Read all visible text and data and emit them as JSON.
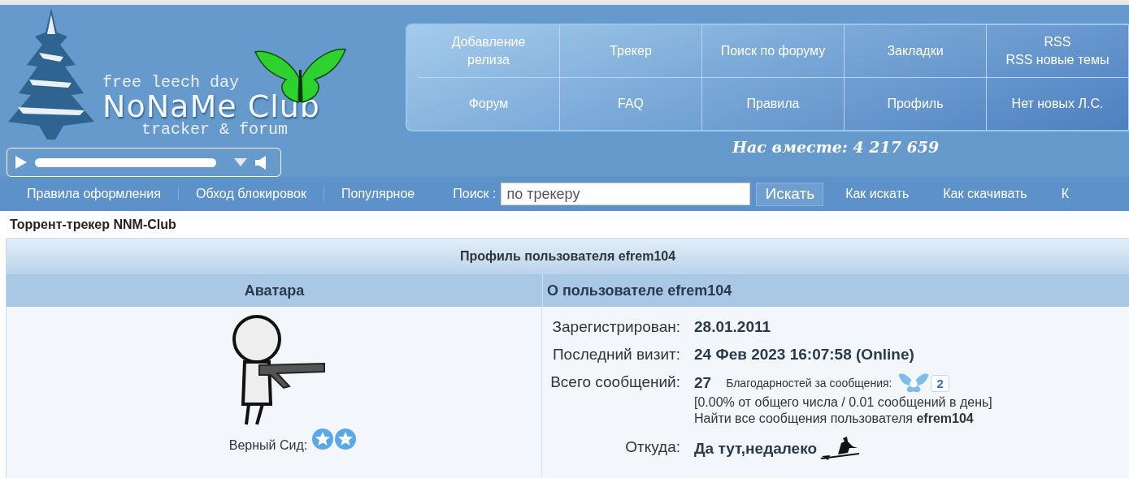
{
  "header": {
    "logo": {
      "tagline": "free leech day",
      "name": "NoNaMe Club",
      "subtitle": "tracker & forum"
    },
    "menu": [
      [
        {
          "labels": [
            "Добавление релиза"
          ]
        },
        {
          "labels": [
            "Трекер"
          ]
        },
        {
          "labels": [
            "Поиск по форуму"
          ]
        },
        {
          "labels": [
            "Закладки"
          ]
        },
        {
          "labels": [
            "RSS",
            "RSS новые темы"
          ]
        }
      ],
      [
        {
          "labels": [
            "Форум"
          ]
        },
        {
          "labels": [
            "FAQ"
          ]
        },
        {
          "labels": [
            "Правила"
          ]
        },
        {
          "labels": [
            "Профиль"
          ]
        },
        {
          "labels": [
            "Нет новых Л.С."
          ]
        }
      ]
    ],
    "online": "Нас вместе: 4 217 659"
  },
  "nav": {
    "links_left": [
      "Правила оформления",
      "Обход блокировок",
      "Популярное"
    ],
    "search": {
      "label": "Поиск :",
      "value": "по трекеру",
      "button": "Искать"
    },
    "links_right": [
      "Как искать",
      "Как скачивать",
      "К"
    ]
  },
  "breadcrumb": "Торрент-трекер NNM-Club",
  "profile": {
    "title": "Профиль пользователя efrem104",
    "avatar_heading": "Аватара",
    "about_heading": "О пользователе efrem104",
    "rank_label": "Верный Сид:",
    "rank_icons": [
      {
        "kind": "star"
      },
      {
        "kind": "star"
      }
    ],
    "registered": {
      "label": "Зарегистрирован:",
      "value": "28.01.2011"
    },
    "last_visit": {
      "label": "Последний визит:",
      "value": "24 Фев 2023 16:07:58 (Online)"
    },
    "posts": {
      "label": "Всего сообщений:",
      "value": "27",
      "thanks_label": "Благодарностей за сообщения:",
      "thanks_count": "2",
      "stats": "[0.00% от общего числа / 0.01 сообщений в день]",
      "find_link": "Найти все сообщения пользователя **efrem104**"
    },
    "from": {
      "label": "Откуда:",
      "value": "Да тут,недалеко"
    }
  }
}
